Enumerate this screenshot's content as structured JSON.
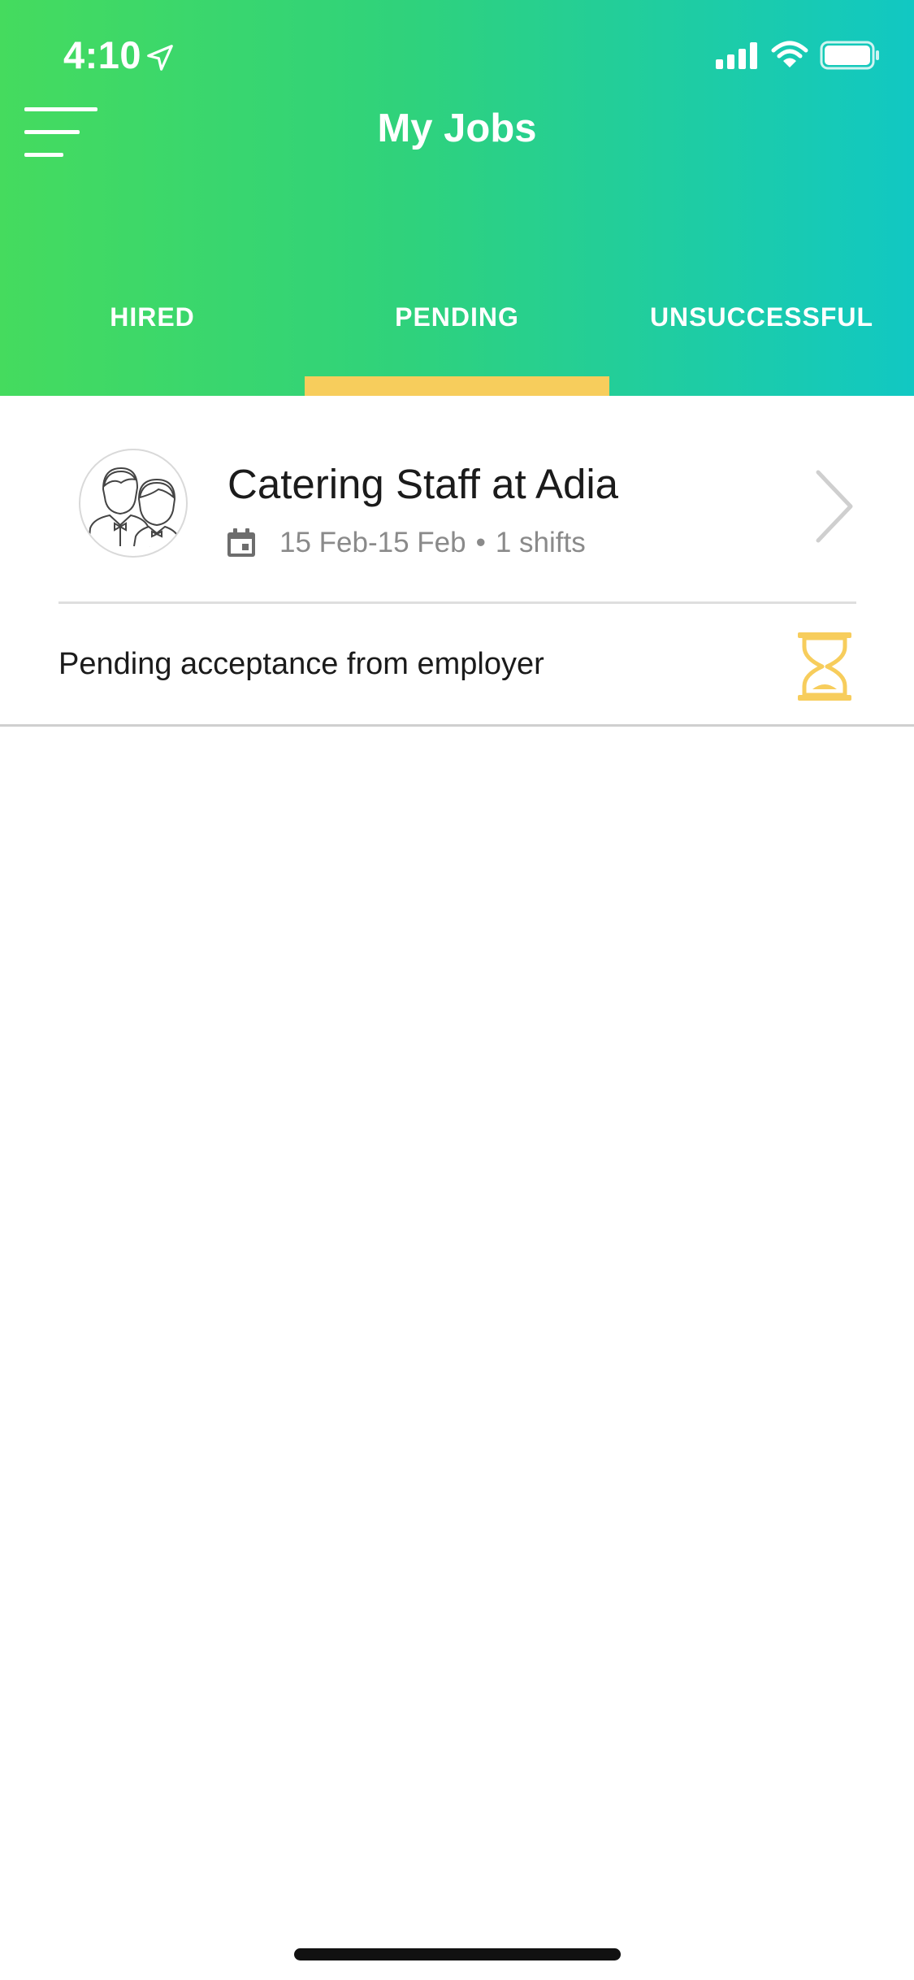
{
  "status_bar": {
    "time": "4:10",
    "icons": [
      "location-arrow-icon",
      "signal-icon",
      "wifi-icon",
      "battery-icon"
    ]
  },
  "header": {
    "title": "My Jobs",
    "menu_icon": "hamburger-menu-icon",
    "gradient_colors": [
      "#45db5e",
      "#11c8c3"
    ]
  },
  "tabs": [
    {
      "label": "HIRED",
      "selected": false
    },
    {
      "label": "PENDING",
      "selected": true
    },
    {
      "label": "UNSUCCESSFUL",
      "selected": false
    }
  ],
  "accent_color": "#f7cd5c",
  "jobs": [
    {
      "title": "Catering Staff at Adia",
      "dates": "15 Feb-15 Feb",
      "separator": "•",
      "shifts": "1 shifts",
      "status": "Pending acceptance from employer",
      "status_icon": "hourglass-icon",
      "avatar_icon": "catering-staff-avatar-icon"
    }
  ]
}
